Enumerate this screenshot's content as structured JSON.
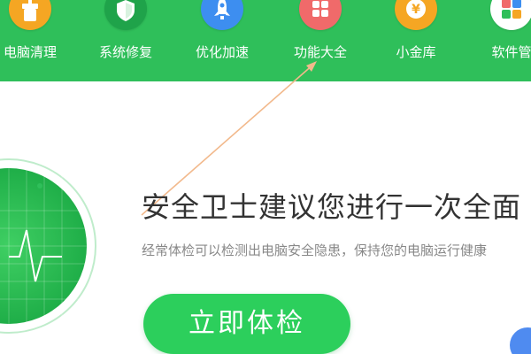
{
  "nav": {
    "items": [
      {
        "label": "电脑清理",
        "icon": "broom-icon",
        "color": "#f5a623"
      },
      {
        "label": "系统修复",
        "icon": "shield-icon",
        "color": "#1fa34a"
      },
      {
        "label": "优化加速",
        "icon": "rocket-icon",
        "color": "#3d8ef0"
      },
      {
        "label": "功能大全",
        "icon": "grid-icon",
        "color": "#f06a6a"
      },
      {
        "label": "小金库",
        "icon": "yuan-coin-icon",
        "color": "#f5a623"
      },
      {
        "label": "软件管",
        "icon": "software-manager-icon",
        "color": "#ffffff"
      }
    ]
  },
  "main": {
    "headline": "安全卫士建议您进行一次全面",
    "subline": "经常体检可以检测出电脑安全隐患，保持您的电脑运行健康",
    "scan_button": "立即体检"
  },
  "colors": {
    "nav_bg": "#2fbf5a",
    "button_bg": "#2ccf5c",
    "radar_green": "#28b34f",
    "arrow": "#f2b98c"
  }
}
